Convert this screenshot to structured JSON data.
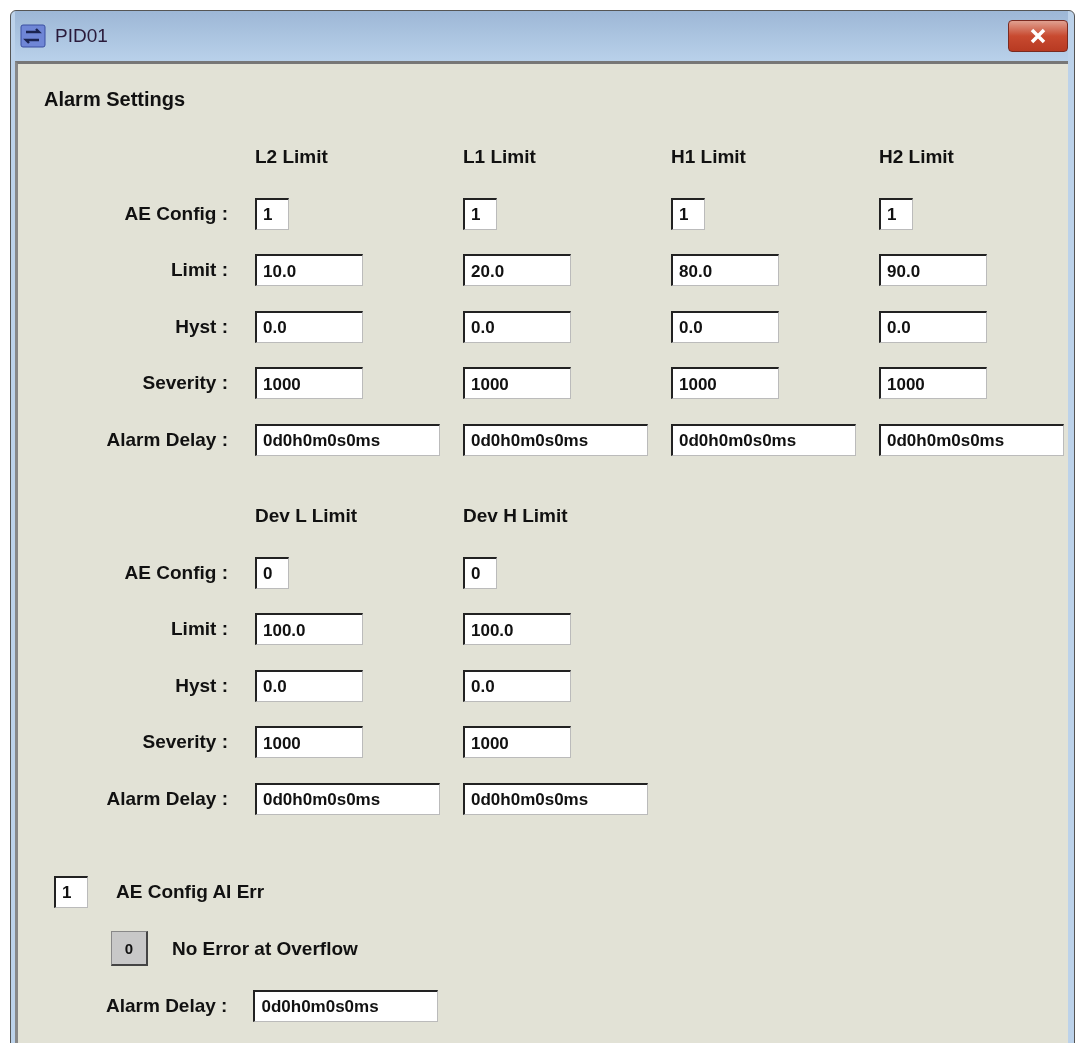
{
  "window": {
    "title": "PID01"
  },
  "heading": "Alarm Settings",
  "sections": [
    {
      "columns": [
        "L2 Limit",
        "L1 Limit",
        "H1 Limit",
        "H2 Limit"
      ],
      "rows": [
        {
          "label": "AE Config :",
          "kind": "config",
          "values": [
            "1",
            "1",
            "1",
            "1"
          ]
        },
        {
          "label": "Limit :",
          "kind": "value",
          "values": [
            "10.0",
            "20.0",
            "80.0",
            "90.0"
          ]
        },
        {
          "label": "Hyst :",
          "kind": "value",
          "values": [
            "0.0",
            "0.0",
            "0.0",
            "0.0"
          ]
        },
        {
          "label": "Severity :",
          "kind": "value",
          "values": [
            "1000",
            "1000",
            "1000",
            "1000"
          ]
        },
        {
          "label": "Alarm Delay :",
          "kind": "delay",
          "values": [
            "0d0h0m0s0ms",
            "0d0h0m0s0ms",
            "0d0h0m0s0ms",
            "0d0h0m0s0ms"
          ]
        }
      ]
    },
    {
      "columns": [
        "Dev L Limit",
        "Dev H Limit"
      ],
      "rows": [
        {
          "label": "AE Config :",
          "kind": "config",
          "values": [
            "0",
            "0"
          ]
        },
        {
          "label": "Limit :",
          "kind": "value",
          "values": [
            "100.0",
            "100.0"
          ]
        },
        {
          "label": "Hyst :",
          "kind": "value",
          "values": [
            "0.0",
            "0.0"
          ]
        },
        {
          "label": "Severity :",
          "kind": "value",
          "values": [
            "1000",
            "1000"
          ]
        },
        {
          "label": "Alarm Delay :",
          "kind": "delay",
          "values": [
            "0d0h0m0s0ms",
            "0d0h0m0s0ms"
          ]
        }
      ]
    }
  ],
  "ai_error": {
    "value": "1",
    "label": "AE Config AI Err"
  },
  "overflow": {
    "button": "0",
    "label": "No Error at Overflow"
  },
  "alarm_delay": {
    "label": "Alarm Delay :",
    "value": "0d0h0m0s0ms"
  }
}
